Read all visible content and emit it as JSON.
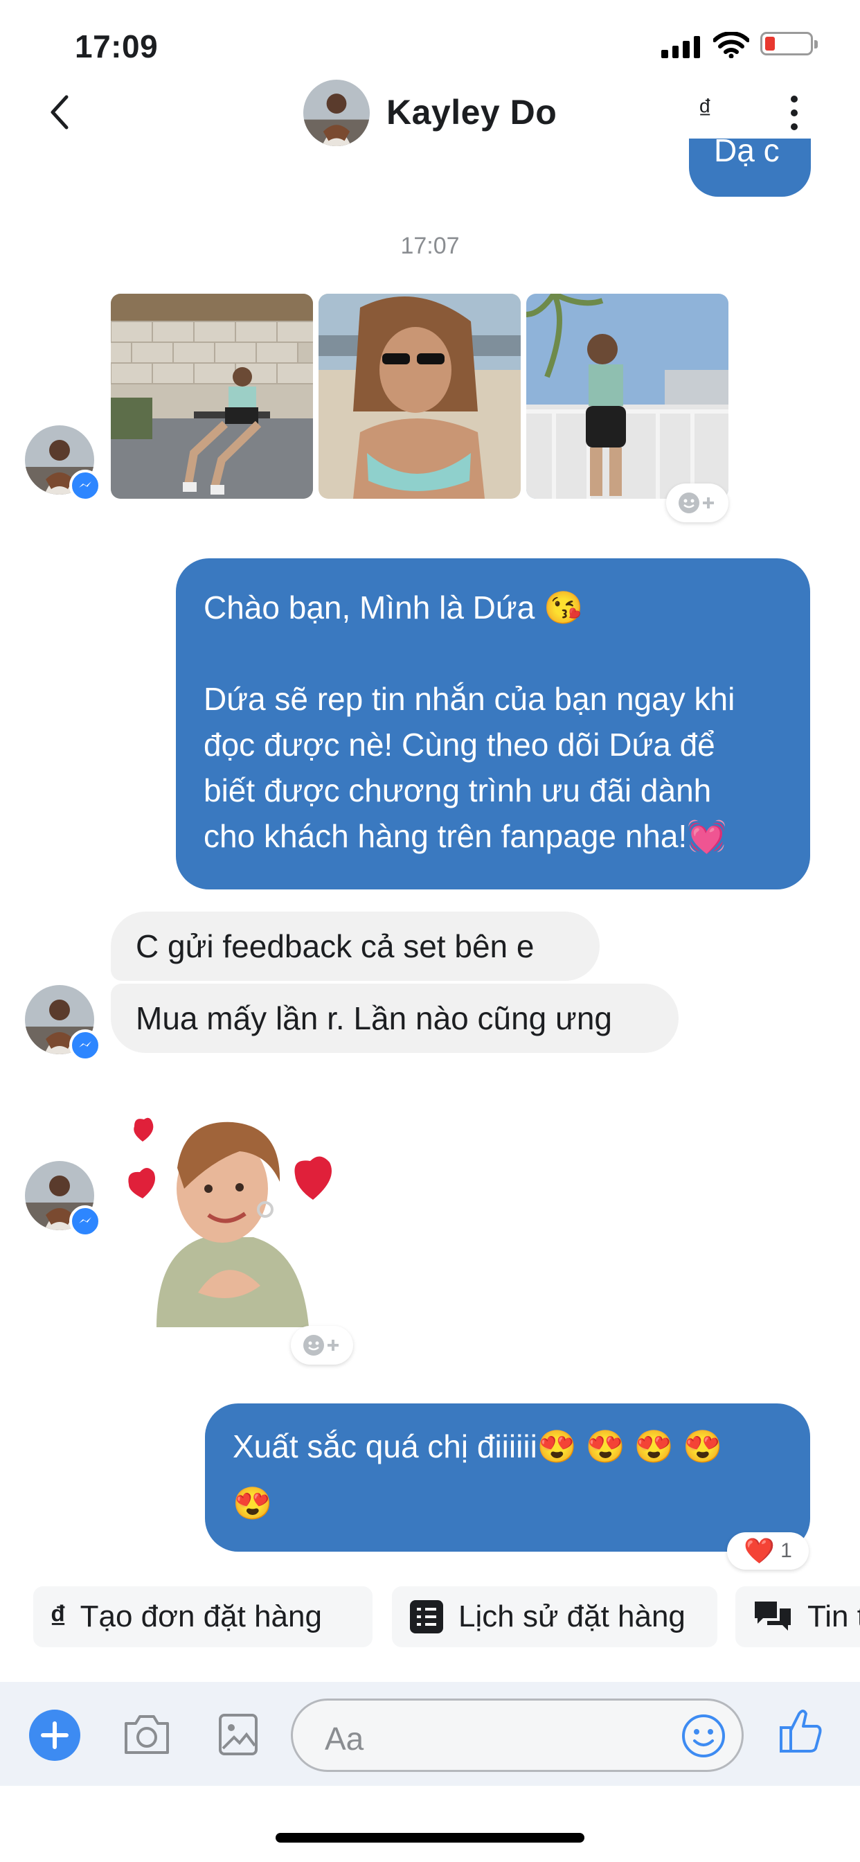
{
  "status_bar": {
    "time": "17:09"
  },
  "header": {
    "contact_name": "Kayley Do",
    "currency_symbol": "₫"
  },
  "conversation": {
    "partial_bubble_text": "Dạ c",
    "timestamp": "17:07",
    "outgoing_1": {
      "lines": [
        "Chào bạn, Mình là Dứa 😘",
        "",
        "Dứa sẽ rep tin nhắn của bạn ngay khi",
        "đọc được nè! Cùng theo dõi Dứa để",
        "biết được chương trình ưu đãi dành",
        "cho khách hàng trên fanpage nha!💓"
      ]
    },
    "incoming": [
      {
        "text": "C gửi feedback cả set bên e"
      },
      {
        "text": "Mua mấy lần r. Lần nào cũng ưng"
      }
    ],
    "outgoing_2": {
      "lines": [
        "Xuất sắc quá chị điiiiii😍 😍 😍 😍",
        "😍"
      ],
      "reaction_emoji": "❤️",
      "reaction_count": "1"
    }
  },
  "quick_actions": [
    {
      "label": "Tạo đơn đặt hàng",
      "icon": "dong-icon"
    },
    {
      "label": "Lịch sử đặt hàng",
      "icon": "list-icon"
    },
    {
      "label": "Tin t",
      "icon": "chat-bubbles-icon"
    }
  ],
  "composer": {
    "placeholder": "Aa"
  },
  "colors": {
    "outgoing_bubble": "#3a79c0",
    "incoming_bubble": "#f1f1f1",
    "accent": "#3d8bf2"
  }
}
